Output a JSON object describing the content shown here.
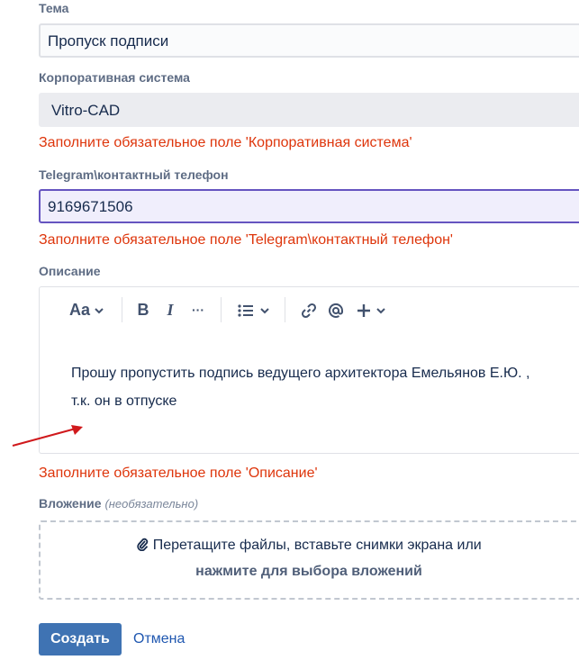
{
  "form": {
    "subject": {
      "label": "Тема",
      "value": "Пропуск подписи"
    },
    "corporate_system": {
      "label": "Корпоративная система",
      "value": "Vitro-CAD",
      "error": "Заполните обязательное поле 'Корпоративная система'"
    },
    "telegram": {
      "label": "Telegram\\контактный телефон",
      "value": "9169671506",
      "error": "Заполните обязательное поле 'Telegram\\контактный телефон'"
    },
    "description": {
      "label": "Описание",
      "text_line1": "Прошу пропустить подпись ведущего архитектора Емельянов Е.Ю. ,",
      "text_line2": "т.к. он в отпуске",
      "error": "Заполните обязательное поле 'Описание'",
      "toolbar": {
        "text_style": "Aa",
        "bold": "B",
        "italic": "I",
        "more": "···"
      }
    },
    "attachment": {
      "label": "Вложение",
      "optional": "(необязательно)",
      "line1": "Перетащите файлы, вставьте снимки экрана или",
      "line2": "нажмите для выбора вложений"
    }
  },
  "actions": {
    "create": "Создать",
    "cancel": "Отмена"
  },
  "colors": {
    "error": "#de350b",
    "primary_button": "#3f73b3",
    "focus_border": "#6554c0",
    "annotation_arrow": "#d0191c"
  },
  "icons": [
    "chevron-down-icon",
    "bullet-list-icon",
    "link-icon",
    "mention-icon",
    "plus-icon",
    "paperclip-icon",
    "arrow-annotation"
  ]
}
